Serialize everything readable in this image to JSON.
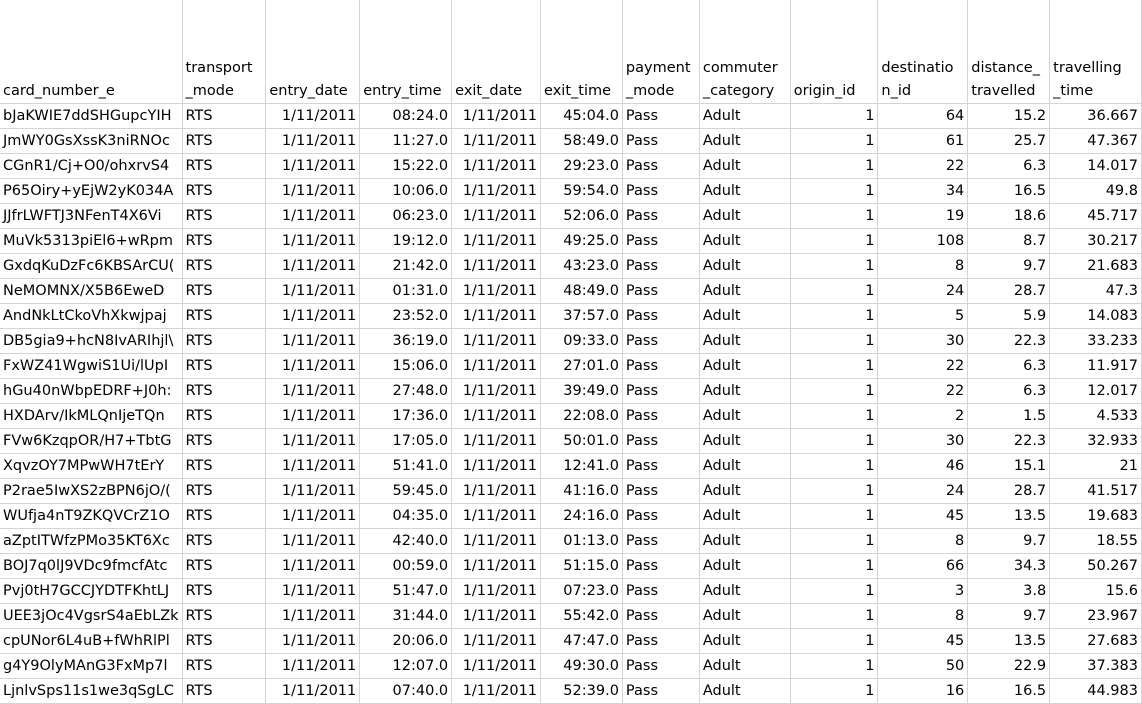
{
  "columns": [
    "card_number_e",
    "transport\n_mode",
    "entry_date",
    "entry_time",
    "exit_date",
    "exit_time",
    "payment\n_mode",
    "commuter\n_category",
    "origin_id",
    "destinatio\nn_id",
    "distance_\ntravelled",
    "travelling\n_time"
  ],
  "rows": [
    [
      "bJaKWIE7ddSHGupcYIH",
      "RTS",
      "1/11/2011",
      "08:24.0",
      "1/11/2011",
      "45:04.0",
      "Pass",
      "Adult",
      "1",
      "64",
      "15.2",
      "36.667"
    ],
    [
      "JmWY0GsXssK3niRNOc",
      "RTS",
      "1/11/2011",
      "11:27.0",
      "1/11/2011",
      "58:49.0",
      "Pass",
      "Adult",
      "1",
      "61",
      "25.7",
      "47.367"
    ],
    [
      "CGnR1/Cj+O0/ohxrvS4",
      "RTS",
      "1/11/2011",
      "15:22.0",
      "1/11/2011",
      "29:23.0",
      "Pass",
      "Adult",
      "1",
      "22",
      "6.3",
      "14.017"
    ],
    [
      "P65Oiry+yEjW2yK034A",
      "RTS",
      "1/11/2011",
      "10:06.0",
      "1/11/2011",
      "59:54.0",
      "Pass",
      "Adult",
      "1",
      "34",
      "16.5",
      "49.8"
    ],
    [
      "JJfrLWFTJ3NFenT4X6Vi",
      "RTS",
      "1/11/2011",
      "06:23.0",
      "1/11/2011",
      "52:06.0",
      "Pass",
      "Adult",
      "1",
      "19",
      "18.6",
      "45.717"
    ],
    [
      "MuVk5313piEl6+wRpm",
      "RTS",
      "1/11/2011",
      "19:12.0",
      "1/11/2011",
      "49:25.0",
      "Pass",
      "Adult",
      "1",
      "108",
      "8.7",
      "30.217"
    ],
    [
      "GxdqKuDzFc6KBSArCU(",
      "RTS",
      "1/11/2011",
      "21:42.0",
      "1/11/2011",
      "43:23.0",
      "Pass",
      "Adult",
      "1",
      "8",
      "9.7",
      "21.683"
    ],
    [
      "NeMOMNX/X5B6EweD",
      "RTS",
      "1/11/2011",
      "01:31.0",
      "1/11/2011",
      "48:49.0",
      "Pass",
      "Adult",
      "1",
      "24",
      "28.7",
      "47.3"
    ],
    [
      "AndNkLtCkoVhXkwjpaj",
      "RTS",
      "1/11/2011",
      "23:52.0",
      "1/11/2011",
      "37:57.0",
      "Pass",
      "Adult",
      "1",
      "5",
      "5.9",
      "14.083"
    ],
    [
      "DB5gia9+hcN8IvARIhjl\\",
      "RTS",
      "1/11/2011",
      "36:19.0",
      "1/11/2011",
      "09:33.0",
      "Pass",
      "Adult",
      "1",
      "30",
      "22.3",
      "33.233"
    ],
    [
      "FxWZ41WgwiS1Ui/lUpI",
      "RTS",
      "1/11/2011",
      "15:06.0",
      "1/11/2011",
      "27:01.0",
      "Pass",
      "Adult",
      "1",
      "22",
      "6.3",
      "11.917"
    ],
    [
      "hGu40nWbpEDRF+J0h:",
      "RTS",
      "1/11/2011",
      "27:48.0",
      "1/11/2011",
      "39:49.0",
      "Pass",
      "Adult",
      "1",
      "22",
      "6.3",
      "12.017"
    ],
    [
      "HXDArv/IkMLQnIjeTQn",
      "RTS",
      "1/11/2011",
      "17:36.0",
      "1/11/2011",
      "22:08.0",
      "Pass",
      "Adult",
      "1",
      "2",
      "1.5",
      "4.533"
    ],
    [
      "FVw6KzqpOR/H7+TbtG",
      "RTS",
      "1/11/2011",
      "17:05.0",
      "1/11/2011",
      "50:01.0",
      "Pass",
      "Adult",
      "1",
      "30",
      "22.3",
      "32.933"
    ],
    [
      "XqvzOY7MPwWH7tErY",
      "RTS",
      "1/11/2011",
      "51:41.0",
      "1/11/2011",
      "12:41.0",
      "Pass",
      "Adult",
      "1",
      "46",
      "15.1",
      "21"
    ],
    [
      "P2rae5IwXS2zBPN6jO/(",
      "RTS",
      "1/11/2011",
      "59:45.0",
      "1/11/2011",
      "41:16.0",
      "Pass",
      "Adult",
      "1",
      "24",
      "28.7",
      "41.517"
    ],
    [
      "WUfja4nT9ZKQVCrZ1O",
      "RTS",
      "1/11/2011",
      "04:35.0",
      "1/11/2011",
      "24:16.0",
      "Pass",
      "Adult",
      "1",
      "45",
      "13.5",
      "19.683"
    ],
    [
      "aZptITWfzPMo35KT6Xc",
      "RTS",
      "1/11/2011",
      "42:40.0",
      "1/11/2011",
      "01:13.0",
      "Pass",
      "Adult",
      "1",
      "8",
      "9.7",
      "18.55"
    ],
    [
      "BOJ7q0lJ9VDc9fmcfAtc",
      "RTS",
      "1/11/2011",
      "00:59.0",
      "1/11/2011",
      "51:15.0",
      "Pass",
      "Adult",
      "1",
      "66",
      "34.3",
      "50.267"
    ],
    [
      "Pvj0tH7GCCJYDTFKhtLJ",
      "RTS",
      "1/11/2011",
      "51:47.0",
      "1/11/2011",
      "07:23.0",
      "Pass",
      "Adult",
      "1",
      "3",
      "3.8",
      "15.6"
    ],
    [
      "UEE3jOc4VgsrS4aEbLZk",
      "RTS",
      "1/11/2011",
      "31:44.0",
      "1/11/2011",
      "55:42.0",
      "Pass",
      "Adult",
      "1",
      "8",
      "9.7",
      "23.967"
    ],
    [
      "cpUNor6L4uB+fWhRlPl",
      "RTS",
      "1/11/2011",
      "20:06.0",
      "1/11/2011",
      "47:47.0",
      "Pass",
      "Adult",
      "1",
      "45",
      "13.5",
      "27.683"
    ],
    [
      "g4Y9OlyMAnG3FxMp7l",
      "RTS",
      "1/11/2011",
      "12:07.0",
      "1/11/2011",
      "49:30.0",
      "Pass",
      "Adult",
      "1",
      "50",
      "22.9",
      "37.383"
    ],
    [
      "LjnlvSps11s1we3qSgLC",
      "RTS",
      "1/11/2011",
      "07:40.0",
      "1/11/2011",
      "52:39.0",
      "Pass",
      "Adult",
      "1",
      "16",
      "16.5",
      "44.983"
    ]
  ]
}
